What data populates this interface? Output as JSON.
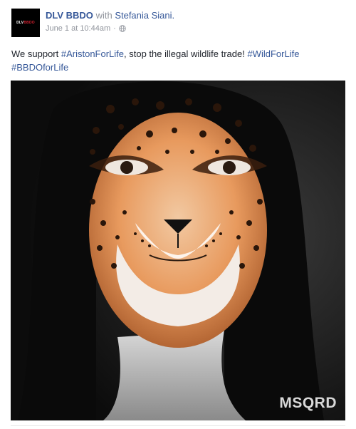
{
  "page": {
    "name": "DLV BBDO",
    "with_text": "with",
    "tagged_person": "Stefania Siani."
  },
  "avatar": {
    "text_white": "DLV",
    "text_red": "BBDO"
  },
  "meta": {
    "timestamp": "June 1 at 10:44am",
    "separator": "·",
    "privacy_icon": "globe-icon"
  },
  "message": {
    "text_before": "We support ",
    "hashtag_1": "#AristonForLife",
    "text_middle": ", stop the illegal wildlife trade! ",
    "hashtag_2": "#WildForLife",
    "hashtag_3": "#BBDOforLife"
  },
  "media": {
    "watermark": "MSQRD"
  },
  "colors": {
    "link": "#365899",
    "text": "#1d2129",
    "muted": "#90949c"
  }
}
